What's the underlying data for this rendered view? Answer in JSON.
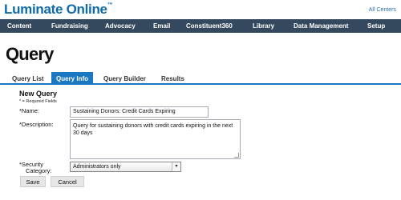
{
  "header": {
    "logo_text": "Luminate Online",
    "logo_tm": "™",
    "all_centers": "All Centers"
  },
  "nav": {
    "items": [
      {
        "label": "Content"
      },
      {
        "label": "Fundraising"
      },
      {
        "label": "Advocacy"
      },
      {
        "label": "Email"
      },
      {
        "label": "Constituent360"
      },
      {
        "label": "Library"
      },
      {
        "label": "Data Management"
      },
      {
        "label": "Setup"
      }
    ]
  },
  "page": {
    "title": "Query"
  },
  "tabs": [
    {
      "label": "Query List",
      "active": false
    },
    {
      "label": "Query Info",
      "active": true
    },
    {
      "label": "Query Builder",
      "active": false
    },
    {
      "label": "Results",
      "active": false
    }
  ],
  "form": {
    "heading": "New Query",
    "required_note": "* = Required Fields",
    "name_label": "*Name:",
    "name_value": "Sustaining Donors: Credit Cards Expiring",
    "description_label": "*Description:",
    "description_value": "Query for sustaining donors with credit cards expiring in the next 30 days",
    "security_label_line1": "*Security",
    "security_label_line2": "Category:",
    "security_value": "Administrators only",
    "save_label": "Save",
    "cancel_label": "Cancel"
  },
  "colors": {
    "navbar_bg": "#34495e",
    "accent": "#1a78c2",
    "logo": "#0e6aa8"
  },
  "icons": {
    "select_arrow": "chevron-down-icon",
    "textarea_grip": "resize-grip-icon"
  }
}
